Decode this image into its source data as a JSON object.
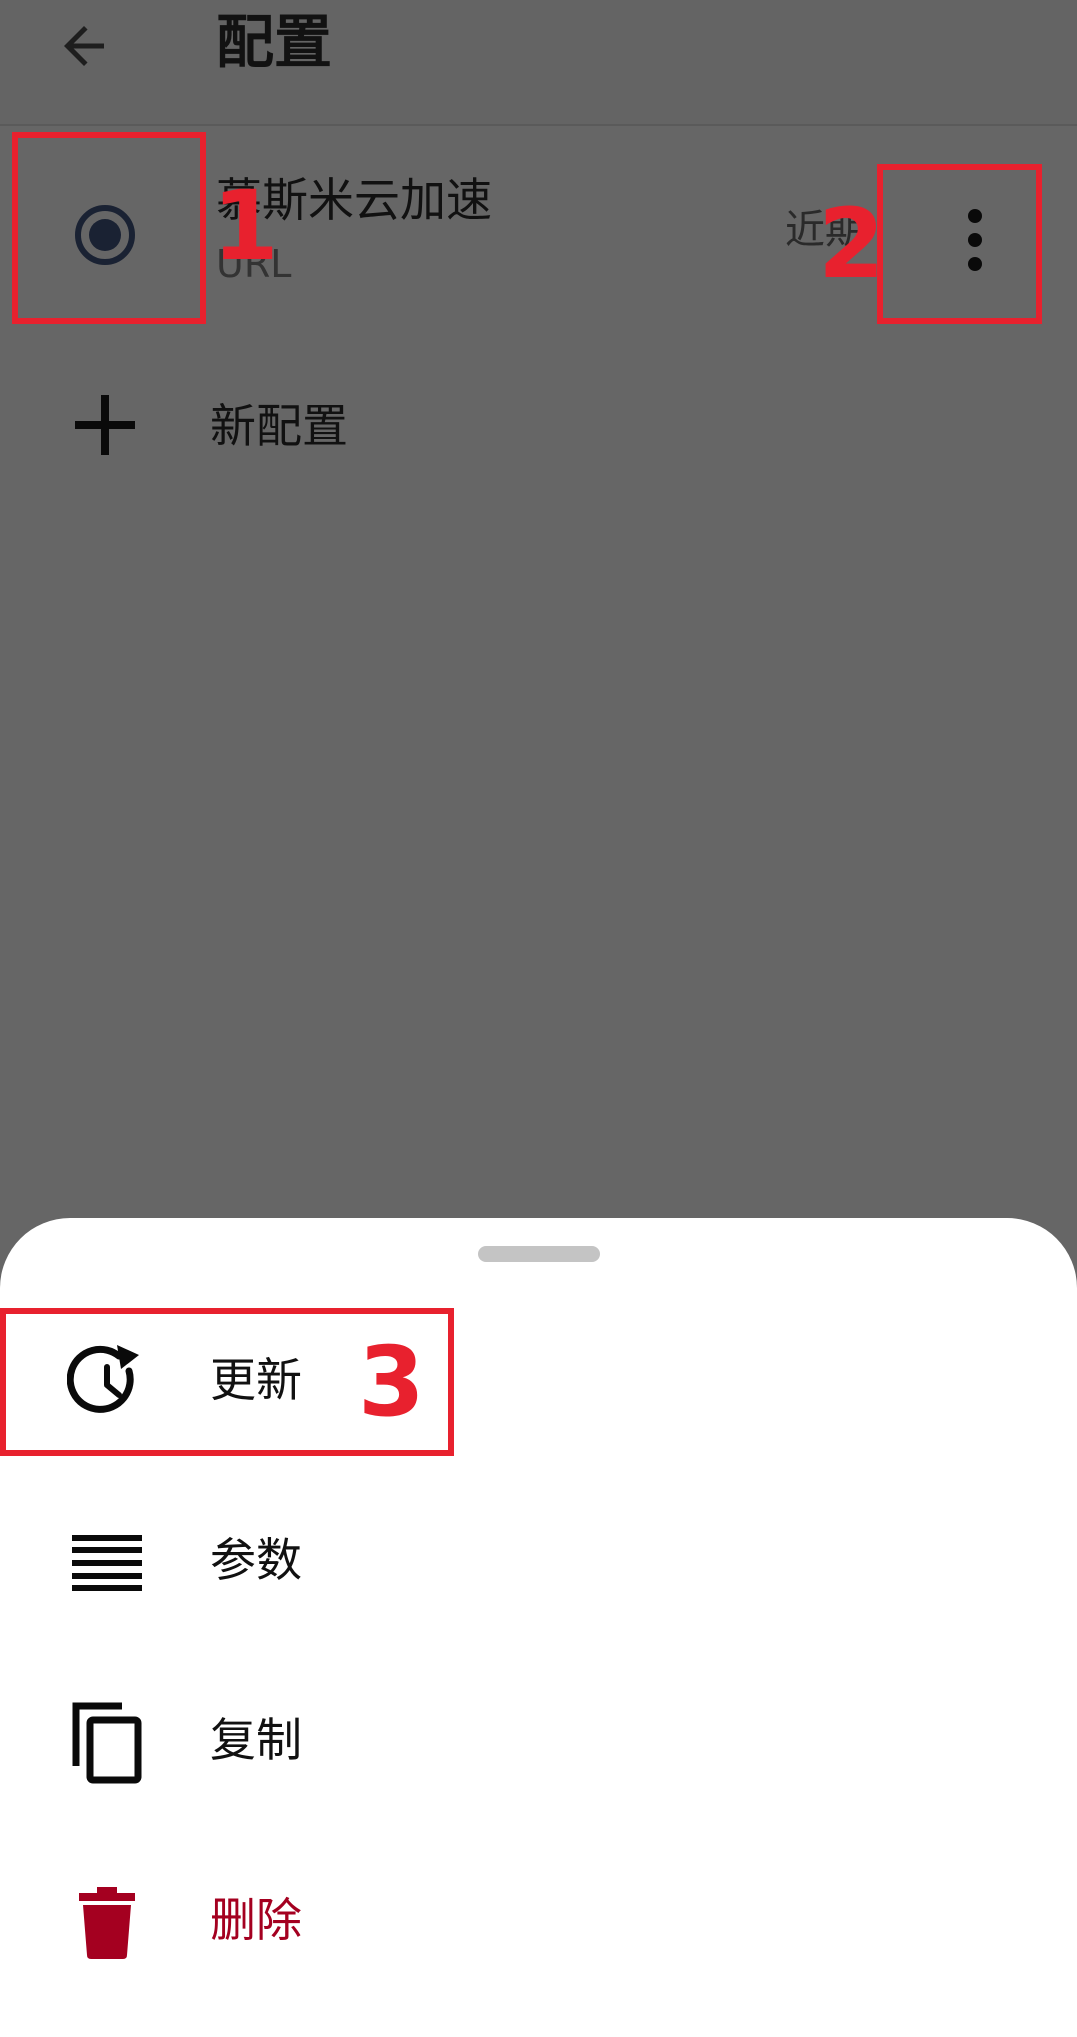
{
  "header": {
    "title": "配置",
    "back_icon": "arrow-back-icon"
  },
  "profile": {
    "name": "慕斯米云加速",
    "type": "URL",
    "updated": "近期",
    "selected": true
  },
  "new_profile": {
    "label": "新配置"
  },
  "menu": {
    "items": [
      {
        "label": "更新",
        "icon": "update-clock-icon"
      },
      {
        "label": "参数",
        "icon": "properties-lines-icon"
      },
      {
        "label": "复制",
        "icon": "copy-icon"
      },
      {
        "label": "删除",
        "icon": "trash-icon",
        "color": "#a40020"
      }
    ]
  },
  "annotations": [
    "1",
    "2",
    "3"
  ],
  "colors": {
    "overlay": "#666666",
    "sheet": "#ffffff",
    "annotation": "#e8212e",
    "danger": "#a40020"
  }
}
